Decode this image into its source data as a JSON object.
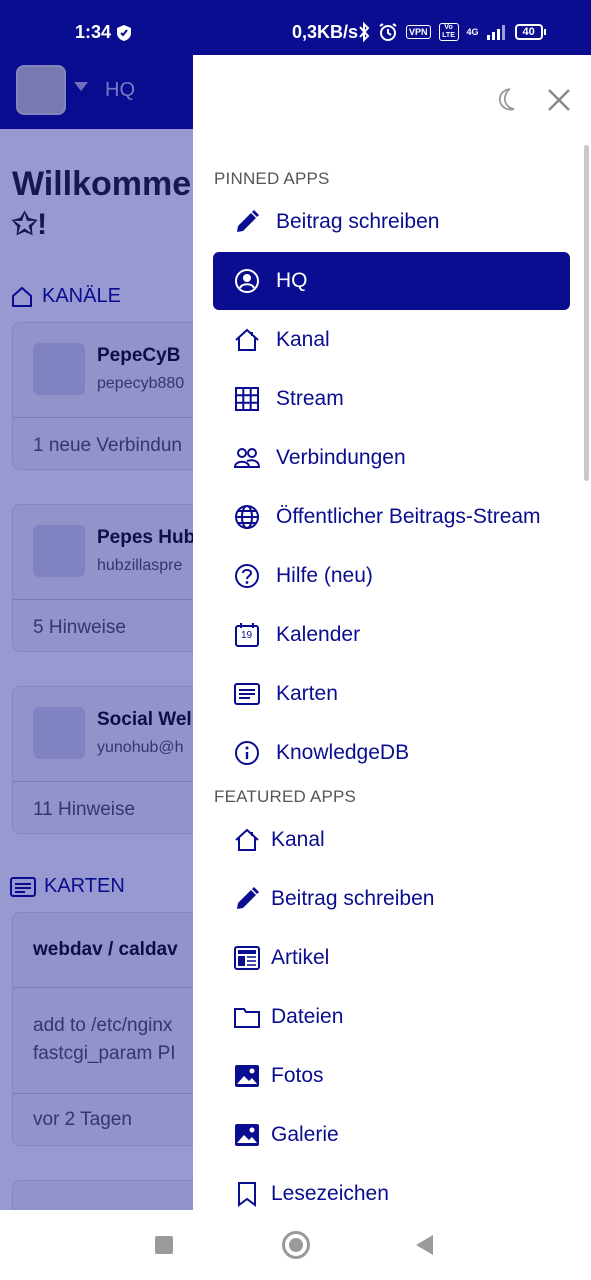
{
  "status_bar": {
    "time": "1:34",
    "speed": "0,3KB/s",
    "vpn": "VPN",
    "volte": "Vo LTE",
    "network": "4G",
    "battery": "40"
  },
  "background": {
    "header_channel": "HQ",
    "welcome_line1": "Willkomme",
    "welcome_line2": "✩!",
    "section_channels": "KANÄLE",
    "section_cards": "KARTEN",
    "cards": [
      {
        "name": "PepeCyB",
        "address": "pepecyb880",
        "footer": "1 neue Verbindun"
      },
      {
        "name": "Pepes Hub",
        "address": "hubzillaspre",
        "footer": "5 Hinweise"
      },
      {
        "name": "Social Wel",
        "address": "yunohub@h",
        "footer": "11 Hinweise"
      }
    ],
    "note_card": {
      "title": "webdav / caldav",
      "body_line1": "add to /etc/nginx",
      "body_line2": "fastcgi_param PI",
      "footer": "vor 2 Tagen"
    }
  },
  "drawer": {
    "pinned_title": "PINNED APPS",
    "featured_title": "FEATURED APPS",
    "pinned": [
      {
        "label": "Beitrag schreiben",
        "icon": "pencil-icon",
        "active": false
      },
      {
        "label": "HQ",
        "icon": "user-circle-icon",
        "active": true
      },
      {
        "label": "Kanal",
        "icon": "home-icon",
        "active": false
      },
      {
        "label": "Stream",
        "icon": "grid-icon",
        "active": false
      },
      {
        "label": "Verbindungen",
        "icon": "people-icon",
        "active": false
      },
      {
        "label": "Öffentlicher Beitrags-Stream",
        "icon": "globe-icon",
        "active": false
      },
      {
        "label": "Hilfe (neu)",
        "icon": "question-icon",
        "active": false
      },
      {
        "label": "Kalender",
        "icon": "calendar-icon",
        "calendar_day": "19",
        "active": false
      },
      {
        "label": "Karten",
        "icon": "card-icon",
        "active": false
      },
      {
        "label": "KnowledgeDB",
        "icon": "info-icon",
        "active": false
      }
    ],
    "featured": [
      {
        "label": "Kanal",
        "icon": "home-icon"
      },
      {
        "label": "Beitrag schreiben",
        "icon": "pencil-icon"
      },
      {
        "label": "Artikel",
        "icon": "newspaper-icon"
      },
      {
        "label": "Dateien",
        "icon": "folder-icon"
      },
      {
        "label": "Fotos",
        "icon": "image-icon"
      },
      {
        "label": "Galerie",
        "icon": "image-icon"
      },
      {
        "label": "Lesezeichen",
        "icon": "bookmark-icon"
      }
    ]
  },
  "colors": {
    "brand": "#0a0d8f",
    "overlay": "rgba(10,13,143,0.42)",
    "text_muted": "#555555"
  }
}
